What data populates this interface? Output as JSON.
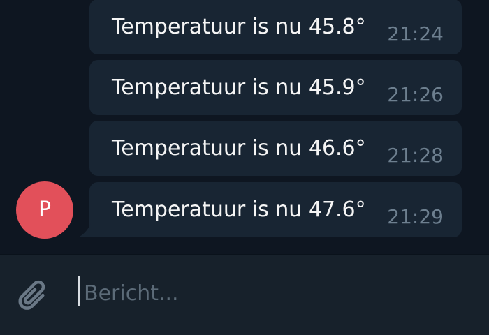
{
  "messages": [
    {
      "text": "Temperatuur is nu 45.8°",
      "time": "21:24"
    },
    {
      "text": "Temperatuur is nu 45.9°",
      "time": "21:26"
    },
    {
      "text": "Temperatuur is nu 46.6°",
      "time": "21:28"
    },
    {
      "text": "Temperatuur is nu 47.6°",
      "time": "21:29"
    }
  ],
  "sender": {
    "initial": "P",
    "avatar_color": "#e2505a"
  },
  "composer": {
    "placeholder": "Bericht...",
    "attach_icon": "paperclip-icon"
  },
  "colors": {
    "chat_background": "#0e1621",
    "bubble": "#182533",
    "composer_background": "#17212b",
    "timestamp": "#6d7f8f"
  }
}
